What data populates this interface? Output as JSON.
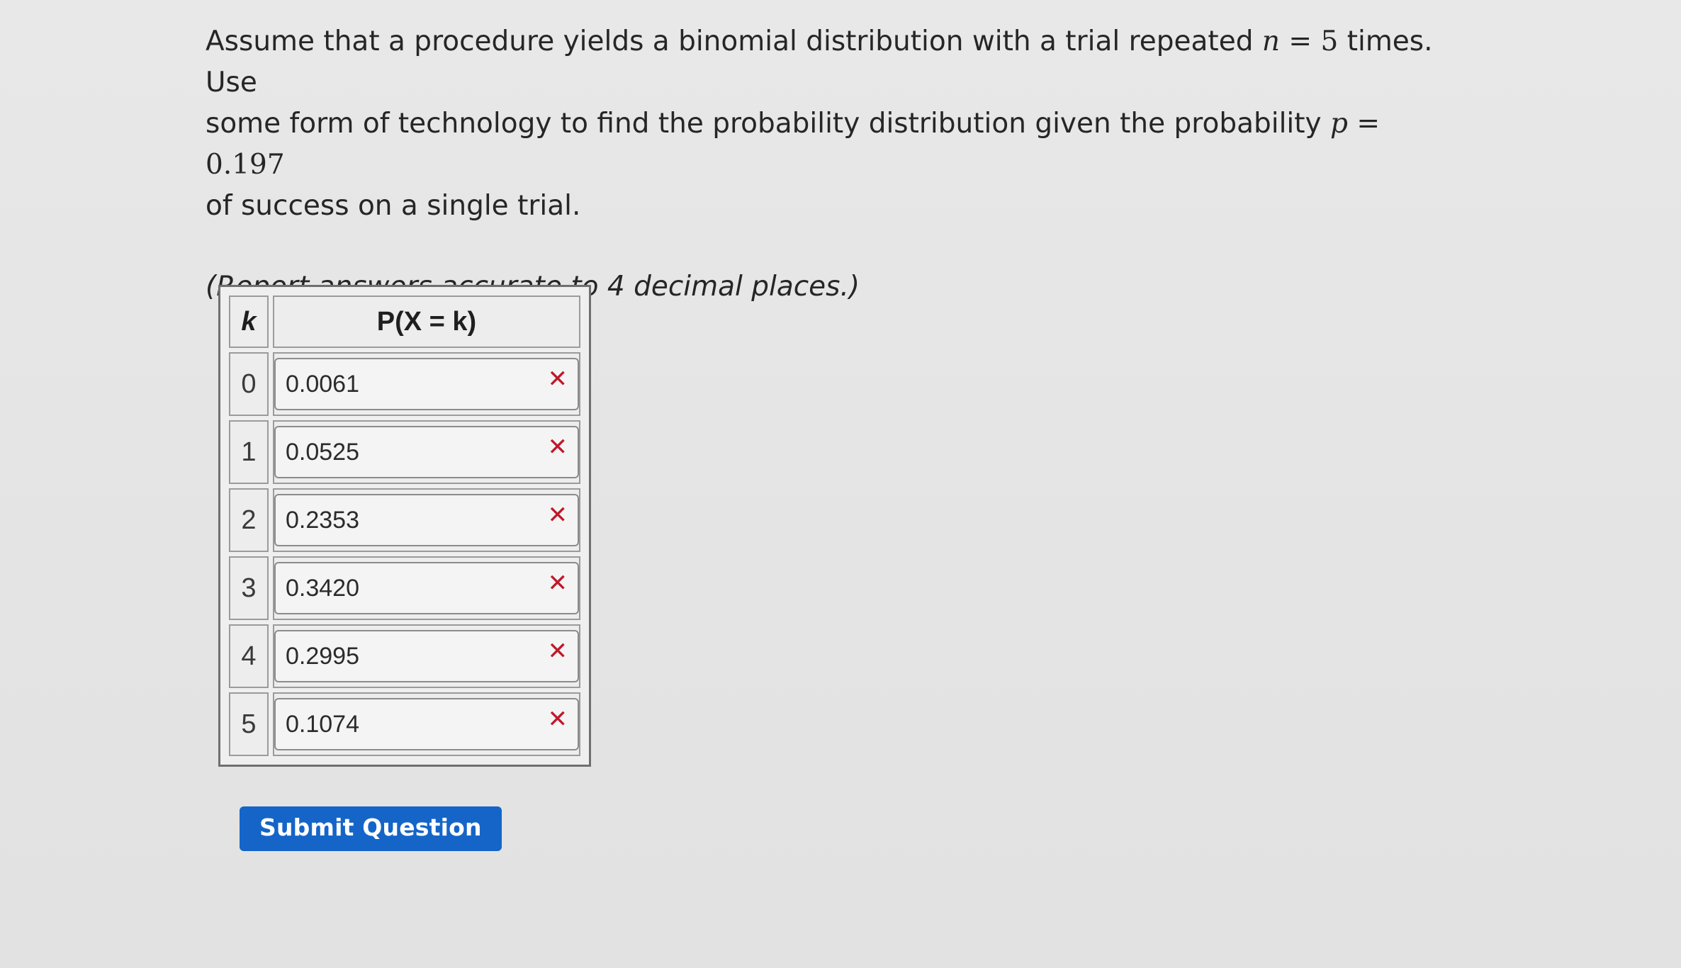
{
  "question": {
    "line1_text": "Assume that a procedure yields a binomial distribution with a trial repeated ",
    "n_var": "n",
    "n_eq": " = ",
    "n_value": "5",
    "line1_end": " times. Use",
    "line2_text": "some form of technology to find the probability distribution given the probability ",
    "p_var": "p",
    "p_eq": " = ",
    "p_value": "0.197",
    "line3_text": "of success on a single trial."
  },
  "instruction": "(Report answers accurate to 4 decimal places.)",
  "table": {
    "header_k": "k",
    "header_p": "P(X = k)",
    "rows": [
      {
        "k": "0",
        "value": "0.0061",
        "mark": "✕"
      },
      {
        "k": "1",
        "value": "0.0525",
        "mark": "✕"
      },
      {
        "k": "2",
        "value": "0.2353",
        "mark": "✕"
      },
      {
        "k": "3",
        "value": "0.3420",
        "mark": "✕"
      },
      {
        "k": "4",
        "value": "0.2995",
        "mark": "✕"
      },
      {
        "k": "5",
        "value": "0.1074",
        "mark": "✕"
      }
    ]
  },
  "submit_label": "Submit Question",
  "colors": {
    "submit_bg": "#1565c8",
    "incorrect_mark": "#c0182a"
  },
  "icons": {
    "incorrect": "x-mark-icon"
  }
}
